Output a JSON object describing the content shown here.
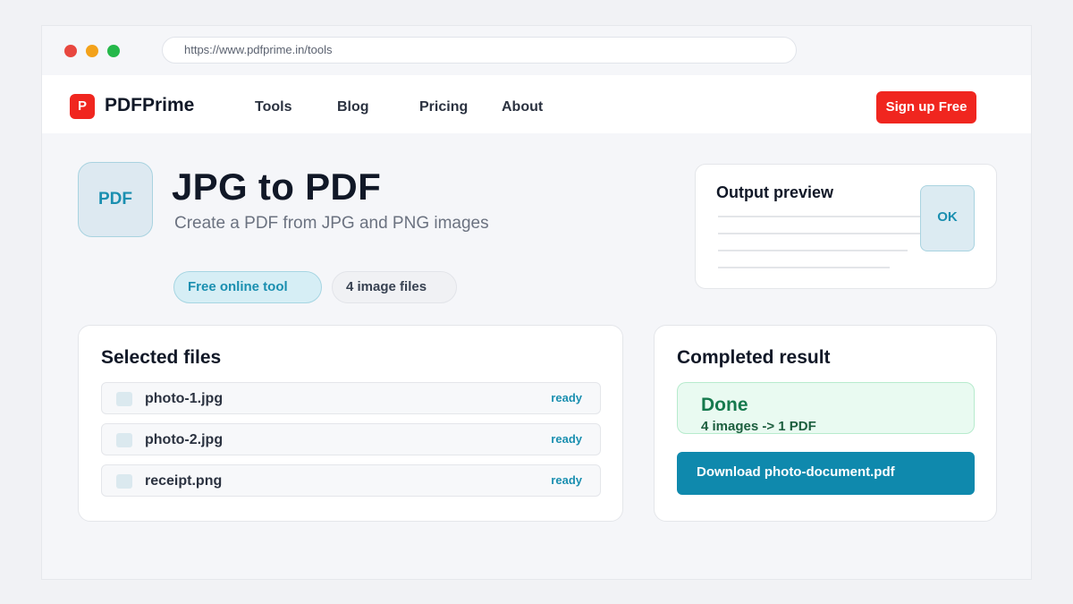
{
  "browser": {
    "url": "https://www.pdfprime.in/tools"
  },
  "navbar": {
    "logo_mark": "P",
    "logo_text": "PDFPrime",
    "links": [
      "Tools",
      "Blog",
      "Pricing",
      "About"
    ],
    "signup_label": "Sign up Free"
  },
  "hero": {
    "icon_label": "PDF",
    "title": "JPG to PDF",
    "subtitle": "Create a PDF from JPG and PNG images",
    "pills": [
      "Free online tool",
      "4 image files"
    ]
  },
  "preview": {
    "title": "Output preview",
    "badge": "OK"
  },
  "files": {
    "title": "Selected files",
    "items": [
      {
        "name": "photo-1.jpg",
        "status": "ready"
      },
      {
        "name": "photo-2.jpg",
        "status": "ready"
      },
      {
        "name": "receipt.png",
        "status": "ready"
      }
    ]
  },
  "result": {
    "title": "Completed result",
    "status_title": "Done",
    "status_detail": "4 images -> 1 PDF",
    "download_label": "Download photo-document.pdf"
  },
  "colors": {
    "brand_red": "#f0261f",
    "accent_teal": "#0f89ad",
    "success_green": "#167a4e"
  }
}
